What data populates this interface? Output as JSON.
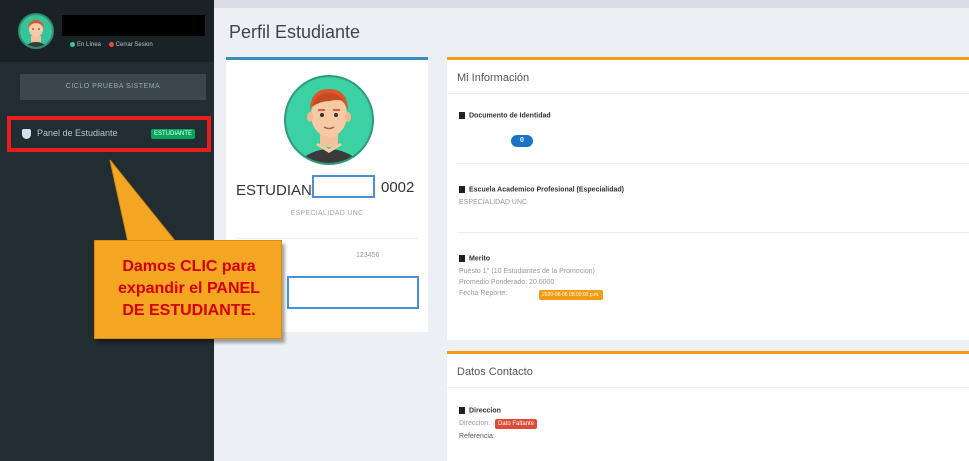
{
  "sidebar": {
    "user_status_online": "En Línea",
    "user_status_logout": "Cerrar Sesion",
    "cycle_button": "CICLO PRUEBA SISTEMA",
    "menu_item_label": "Panel de Estudiante",
    "menu_item_badge": "ESTUDIANTE"
  },
  "callout": {
    "text": "Damos CLIC para\nexpandir el PANEL\nDE ESTUDIANTE."
  },
  "header": {
    "title": "Perfil Estudiante"
  },
  "profile": {
    "name_prefix": "ESTUDIANTE",
    "name_suffix": "0002",
    "specialty": "ESPECIALIDAD UNC",
    "code": "123456"
  },
  "info": {
    "title": "Mi Información",
    "doc_label": "Documento de Identidad",
    "doc_value": "0",
    "school_label": "Escuela Academico Profesional (Especialidad)",
    "school_value": "ESPECIALIDAD UNC",
    "merit_label": "Merito",
    "merit_line1": "Puesto 1° (10 Estudiantes de la Promocion)",
    "merit_line2": "Promedio Ponderado: 20.0000",
    "merit_line3_prefix": "Fecha Reporte:",
    "merit_date_badge": "2020-08-06 08:00:00 p.m."
  },
  "contact": {
    "title": "Datos Contacto",
    "address_label": "Direccion",
    "address_prefix": "Direccion:",
    "address_badge": "Dato Faltante",
    "reference_label": "Referencia:"
  },
  "colors": {
    "sidebar_bg": "#222d32",
    "highlight_border": "#e61e1e",
    "callout_bg": "#f5a623",
    "callout_text": "#d60000",
    "panel_accent": "#f39c12",
    "profile_accent": "#3c8dbc"
  }
}
